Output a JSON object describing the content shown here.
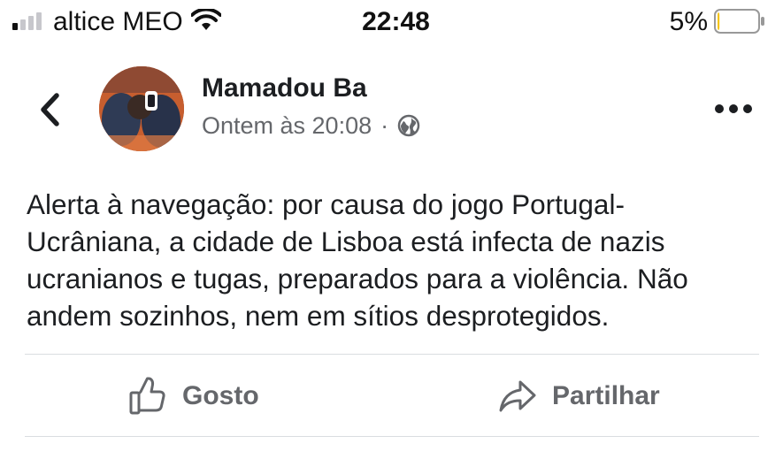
{
  "status_bar": {
    "carrier": "altice MEO",
    "time": "22:48",
    "battery_percent": "5%",
    "battery_level": 0.05,
    "signal_bars_filled": 1,
    "signal_bars_total": 4
  },
  "post": {
    "author": "Mamadou Ba",
    "timestamp": "Ontem às 20:08",
    "separator": "·",
    "audience_icon": "globe-icon",
    "text": "Alerta à navegação: por causa do jogo Portugal-\nUcrâniana, a cidade de Lisboa está infecta de nazis\nucranianos e tugas, preparados para a violência. Não\nandem sozinhos, nem em sítios desprotegidos."
  },
  "actions": {
    "like_label": "Gosto",
    "share_label": "Partilhar"
  },
  "icons": {
    "back": "chevron-left-icon",
    "more": "more-horizontal-icon",
    "like": "thumbs-up-icon",
    "share": "share-arrow-icon"
  },
  "colors": {
    "text": "#1c1e21",
    "secondary_text": "#65676b",
    "divider": "#dadde1",
    "battery_low": "#f5c518"
  }
}
